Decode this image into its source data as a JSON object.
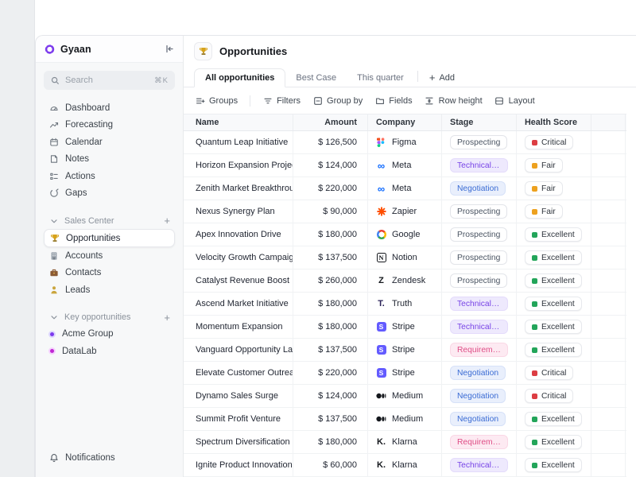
{
  "brand": {
    "name": "Gyaan"
  },
  "search": {
    "placeholder": "Search",
    "shortcut": "⌘K"
  },
  "sidebar": {
    "nav": [
      {
        "label": "Dashboard",
        "icon": "dashboard-icon"
      },
      {
        "label": "Forecasting",
        "icon": "forecasting-icon"
      },
      {
        "label": "Calendar",
        "icon": "calendar-icon"
      },
      {
        "label": "Notes",
        "icon": "notes-icon"
      },
      {
        "label": "Actions",
        "icon": "actions-icon"
      },
      {
        "label": "Gaps",
        "icon": "gaps-icon"
      }
    ],
    "sections": [
      {
        "title": "Sales Center",
        "items": [
          {
            "label": "Opportunities",
            "icon": "trophy-icon",
            "selected": true
          },
          {
            "label": "Accounts",
            "icon": "building-icon",
            "selected": false
          },
          {
            "label": "Contacts",
            "icon": "briefcase-icon",
            "selected": false
          },
          {
            "label": "Leads",
            "icon": "person-icon",
            "selected": false
          }
        ]
      },
      {
        "title": "Key opportunities",
        "items": [
          {
            "label": "Acme Group",
            "dot": "#7c3aed",
            "ring": "#ddd6fe"
          },
          {
            "label": "DataLab",
            "dot": "#c026d3",
            "ring": "#f5d0fe"
          }
        ]
      }
    ],
    "footer": {
      "label": "Notifications"
    }
  },
  "header": {
    "title": "Opportunities"
  },
  "tabs": {
    "items": [
      {
        "label": "All opportunities",
        "active": true
      },
      {
        "label": "Best Case",
        "active": false
      },
      {
        "label": "This quarter",
        "active": false
      }
    ],
    "add_label": "Add"
  },
  "toolbar": {
    "buttons": [
      {
        "label": "Groups",
        "icon": "groups-icon"
      },
      {
        "label": "Filters",
        "icon": "filters-icon"
      },
      {
        "label": "Group by",
        "icon": "group-by-icon"
      },
      {
        "label": "Fields",
        "icon": "fields-icon"
      },
      {
        "label": "Row height",
        "icon": "row-height-icon"
      },
      {
        "label": "Layout",
        "icon": "layout-icon"
      }
    ]
  },
  "table": {
    "columns": [
      "Name",
      "Amount",
      "Company",
      "Stage",
      "Health Score"
    ],
    "rows": [
      {
        "name": "Quantum Leap Initiative",
        "amount": "$ 126,500",
        "company": "Figma",
        "stage": "Prospecting",
        "health": "Critical"
      },
      {
        "name": "Horizon Expansion Project",
        "amount": "$ 124,000",
        "company": "Meta",
        "stage": "Technical win",
        "health": "Fair"
      },
      {
        "name": "Zenith Market Breakthrough",
        "amount": "$ 220,000",
        "company": "Meta",
        "stage": "Negotiation",
        "health": "Fair"
      },
      {
        "name": "Nexus Synergy Plan",
        "amount": "$ 90,000",
        "company": "Zapier",
        "stage": "Prospecting",
        "health": "Fair"
      },
      {
        "name": "Apex Innovation Drive",
        "amount": "$ 180,000",
        "company": "Google",
        "stage": "Prospecting",
        "health": "Excellent"
      },
      {
        "name": "Velocity Growth Campaign",
        "amount": "$ 137,500",
        "company": "Notion",
        "stage": "Prospecting",
        "health": "Excellent"
      },
      {
        "name": "Catalyst Revenue Boost",
        "amount": "$ 260,000",
        "company": "Zendesk",
        "stage": "Prospecting",
        "health": "Excellent"
      },
      {
        "name": "Ascend Market Initiative",
        "amount": "$ 180,000",
        "company": "Truth",
        "stage": "Technical win",
        "health": "Excellent"
      },
      {
        "name": "Momentum Expansion",
        "amount": "$ 180,000",
        "company": "Stripe",
        "stage": "Technical win",
        "health": "Excellent"
      },
      {
        "name": "Vanguard Opportunity Launch",
        "amount": "$ 137,500",
        "company": "Stripe",
        "stage": "Requirement...",
        "health": "Excellent"
      },
      {
        "name": "Elevate Customer Outreach",
        "amount": "$ 220,000",
        "company": "Stripe",
        "stage": "Negotiation",
        "health": "Critical"
      },
      {
        "name": "Dynamo Sales Surge",
        "amount": "$ 124,000",
        "company": "Medium",
        "stage": "Negotiation",
        "health": "Critical"
      },
      {
        "name": "Summit Profit Venture",
        "amount": "$ 137,500",
        "company": "Medium",
        "stage": "Negotiation",
        "health": "Excellent"
      },
      {
        "name": "Spectrum Diversification Plan",
        "amount": "$ 180,000",
        "company": "Klarna",
        "stage": "Requirement...",
        "health": "Excellent"
      },
      {
        "name": "Ignite Product Innovation",
        "amount": "$ 60,000",
        "company": "Klarna",
        "stage": "Technical win",
        "health": "Excellent"
      }
    ],
    "stage_styles": {
      "Prospecting": {
        "bg": "#ffffff",
        "text": "#4b5563",
        "border": "#e2e4e9"
      },
      "Technical win": {
        "bg": "#eee9fd",
        "text": "#7743e6",
        "border": "#e4dbfb"
      },
      "Negotiation": {
        "bg": "#e9effc",
        "text": "#3b6cd4",
        "border": "#d6e1f8"
      },
      "Requirement...": {
        "bg": "#fdeaf2",
        "text": "#df4d86",
        "border": "#fad7e5"
      }
    },
    "health_colors": {
      "Critical": "#dc3d43",
      "Fair": "#eda11f",
      "Excellent": "#23a55a"
    },
    "brand_colors": {
      "logo_purple": "#7c3aed",
      "stripe": "#635bff",
      "meta": "#0866ff",
      "zapier": "#ff4f00"
    }
  }
}
